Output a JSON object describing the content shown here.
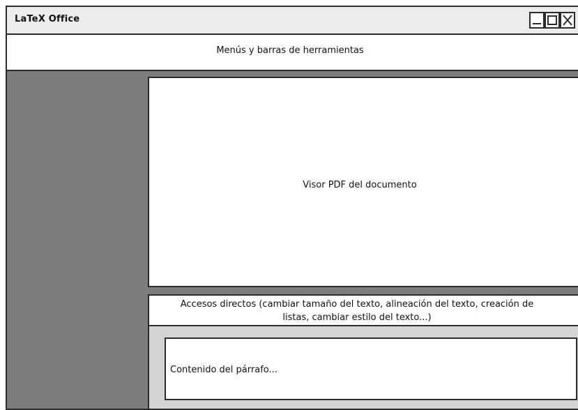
{
  "window": {
    "title": "LaTeX Office",
    "controls": {
      "minimize_icon": "minimize-icon",
      "maximize_icon": "maximize-icon",
      "close_icon": "close-icon"
    }
  },
  "menubar": {
    "label": "Menús y barras de herramientas"
  },
  "viewer": {
    "label": "Visor PDF del documento"
  },
  "shortcuts": {
    "line1": "Accesos directos (cambiar tamaño del texto, alineación del texto, creación de",
    "line2": "listas, cambiar estilo del texto...)"
  },
  "editor": {
    "paragraph": "Contenido del párrafo..."
  },
  "colors": {
    "side_panel": "#7d7d7d",
    "editor_bg": "#d4d4d4",
    "titlebar_bg": "#ececec",
    "border": "#2b2b2b"
  }
}
